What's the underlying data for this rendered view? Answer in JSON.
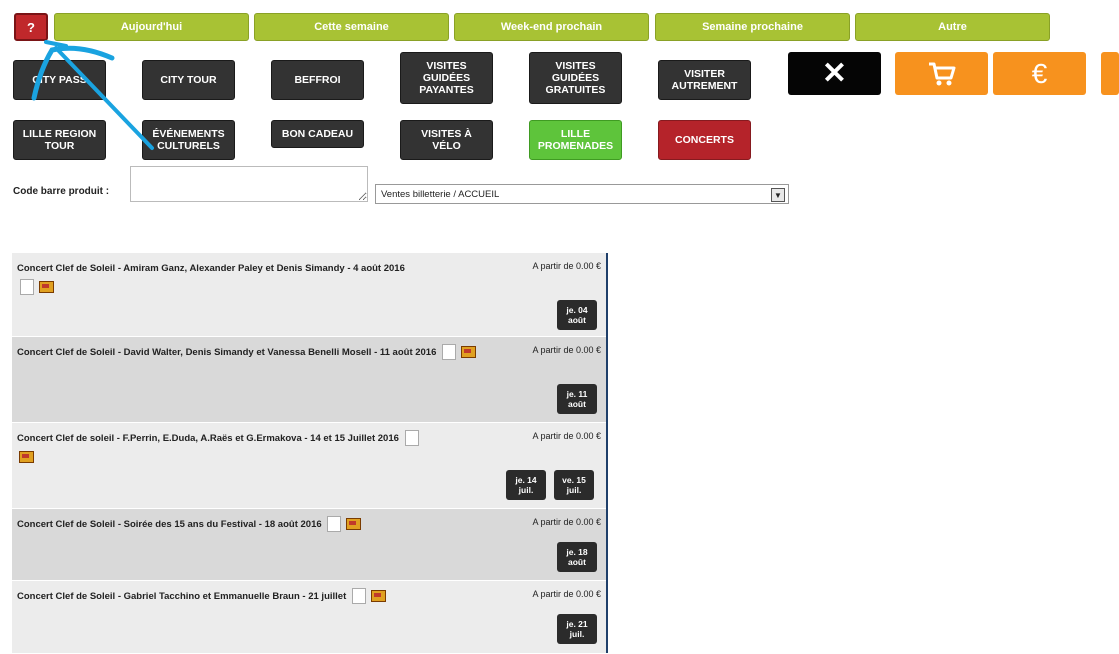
{
  "filters": {
    "help_label": "?",
    "items": [
      "Aujourd'hui",
      "Cette semaine",
      "Week-end prochain",
      "Semaine prochaine",
      "Autre"
    ]
  },
  "tiles": {
    "city_pass": "CITY PASS",
    "city_tour": "CITY TOUR",
    "beffroi": "BEFFROI",
    "visites_payantes": "VISITES\nGUIDÉES\nPAYANTES",
    "visites_gratuites": "VISITES\nGUIDÉES\nGRATUITES",
    "visiter_autrement": "VISITER\nAUTREMENT",
    "lille_region_tour": "LILLE REGION\nTOUR",
    "evenements_culturels": "ÉVÉNEMENTS\nCULTURELS",
    "bon_cadeau": "BON CADEAU",
    "visites_velo": "VISITES À\nVÉLO",
    "lille_promenades": "LILLE\nPROMENADES",
    "concerts": "CONCERTS"
  },
  "actions": {
    "close_symbol": "✕",
    "cart_icon": "cart-icon",
    "euro_symbol": "€"
  },
  "barcode": {
    "label": "Code barre produit :",
    "select_value": "Ventes billetterie / ACCUEIL"
  },
  "events": [
    {
      "title": "Concert Clef de Soleil - Amiram Ganz, Alexander Paley et Denis Simandy - 4 août 2016",
      "price": "A partir de 0.00 €",
      "dates": [
        {
          "day": "je. 04",
          "month": "août"
        }
      ]
    },
    {
      "title": "Concert Clef de Soleil - David Walter, Denis Simandy et Vanessa Benelli Mosell - 11 août 2016",
      "price": "A partir de 0.00 €",
      "dates": [
        {
          "day": "je. 11",
          "month": "août"
        }
      ]
    },
    {
      "title": "Concert Clef de soleil - F.Perrin, E.Duda, A.Raës et G.Ermakova - 14 et 15 Juillet 2016",
      "price": "A partir de 0.00 €",
      "dates": [
        {
          "day": "je. 14",
          "month": "juil."
        },
        {
          "day": "ve. 15",
          "month": "juil."
        }
      ]
    },
    {
      "title": "Concert Clef de Soleil - Soirée des 15 ans du Festival - 18 août 2016",
      "price": "A partir de 0.00 €",
      "dates": [
        {
          "day": "je. 18",
          "month": "août"
        }
      ]
    },
    {
      "title": "Concert Clef de Soleil - Gabriel Tacchino et Emmanuelle Braun - 21 juillet",
      "price": "A partir de 0.00 €",
      "dates": [
        {
          "day": "je. 21",
          "month": "juil."
        }
      ]
    }
  ],
  "colors": {
    "filter_green": "#a8c234",
    "tile_dark": "#333333",
    "tile_green": "#5ec43b",
    "tile_red": "#b5232a",
    "orange": "#f7921e",
    "annotation_blue": "#1aa3e0"
  }
}
